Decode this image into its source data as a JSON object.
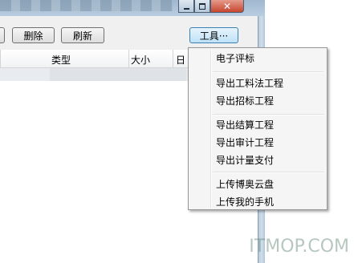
{
  "toolbar": {
    "delete_label": "删除",
    "refresh_label": "刷新",
    "tools_label": "工具···"
  },
  "list": {
    "columns": [
      "类型",
      "大小",
      "日"
    ]
  },
  "menu": {
    "items": [
      "电子评标",
      "导出工料法工程",
      "导出招标工程",
      "导出结算工程",
      "导出审计工程",
      "导出计量支付",
      "上传博奥云盘",
      "上传我的手机"
    ]
  },
  "watermark": "ITMOP.COM",
  "colors": {
    "menu_bg": "#f5f5f5",
    "titlebar": "#b9cde0",
    "close_button": "#c7452e"
  }
}
